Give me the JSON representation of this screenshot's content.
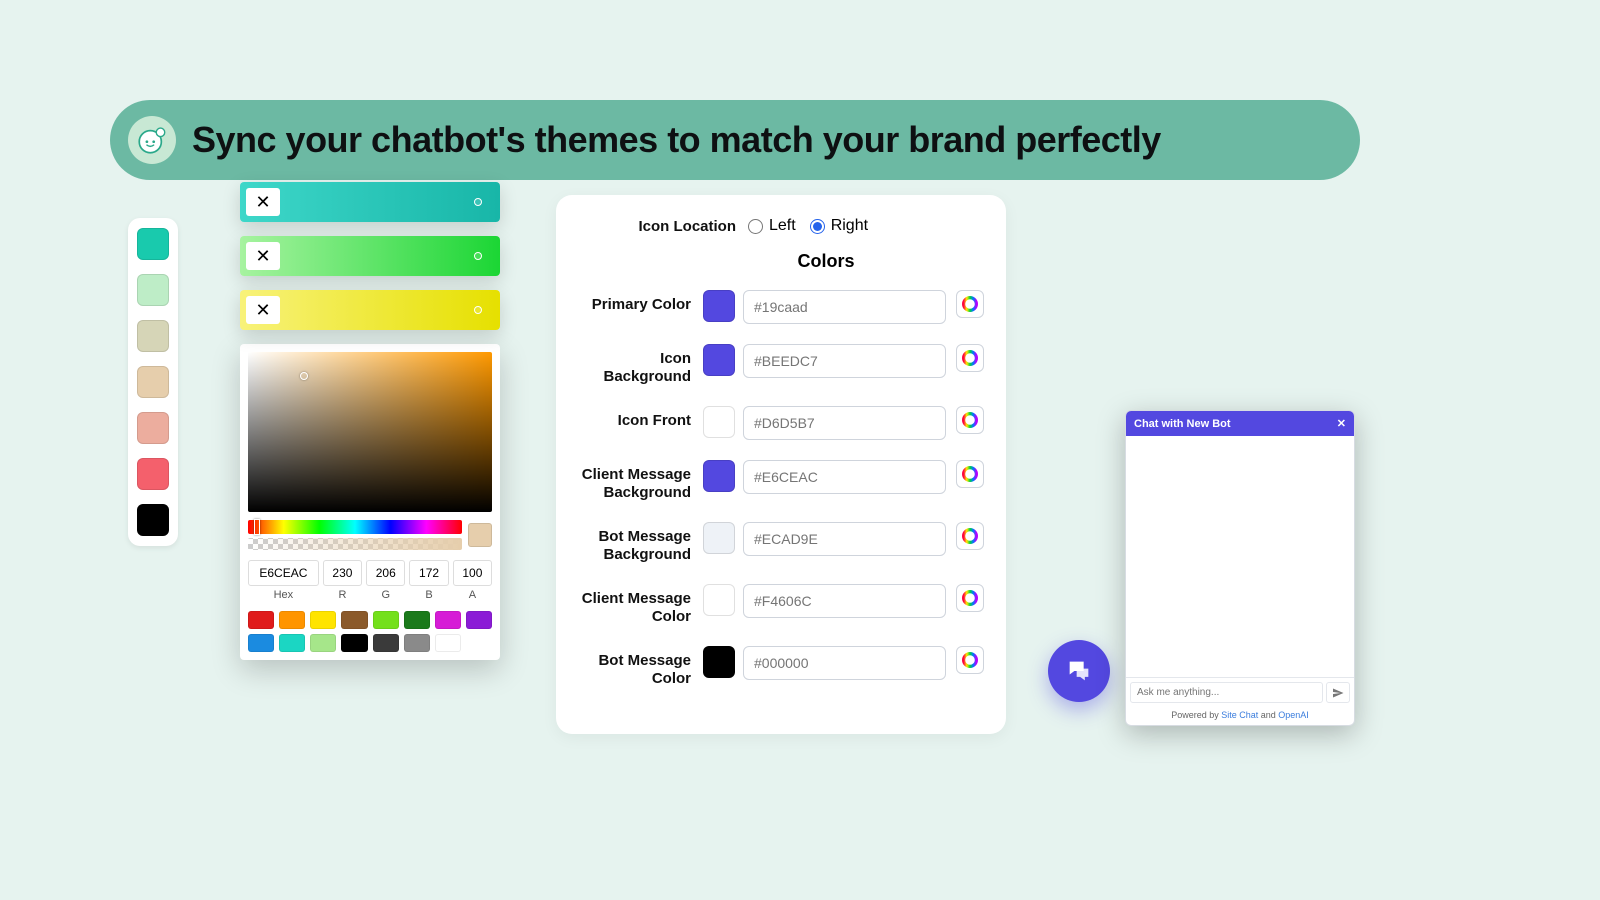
{
  "banner": {
    "title": "Sync your chatbot's themes to match your brand perfectly"
  },
  "palette_swatches": [
    "#19caad",
    "#beedc7",
    "#d6d5b7",
    "#e6ceac",
    "#ecad9e",
    "#f4606c",
    "#000000"
  ],
  "pickers": {
    "collapsed": [
      {
        "bg": "linear-gradient(to right,#3ed7c9,#18b6a8)"
      },
      {
        "bg": "linear-gradient(to right,#a7f3a0,#1bd634)"
      },
      {
        "bg": "linear-gradient(to right,#f8f27a,#e6e000)"
      }
    ],
    "hex": "E6CEAC",
    "r": "230",
    "g": "206",
    "b": "172",
    "a": "100",
    "labels": {
      "hex": "Hex",
      "r": "R",
      "g": "G",
      "b": "B",
      "a": "A"
    },
    "presets": [
      "#e01b1b",
      "#ff9500",
      "#ffe400",
      "#8b5a2b",
      "#74e01b",
      "#1b7a1b",
      "#d61bd6",
      "#8b1bd6",
      "#1b8be0",
      "#1bd6c3",
      "#a6e68a",
      "#000000",
      "#3a3a3a",
      "#8a8a8a",
      "#ffffff"
    ]
  },
  "form": {
    "icon_location_label": "Icon Location",
    "left_label": "Left",
    "right_label": "Right",
    "colors_heading": "Colors",
    "rows": [
      {
        "label": "Primary Color",
        "swatch": "#5348e0",
        "placeholder": "#19caad"
      },
      {
        "label": "Icon Background",
        "swatch": "#5348e0",
        "placeholder": "#BEEDC7"
      },
      {
        "label": "Icon Front",
        "swatch": "#ffffff",
        "placeholder": "#D6D5B7"
      },
      {
        "label": "Client Message Background",
        "swatch": "#5348e0",
        "placeholder": "#E6CEAC"
      },
      {
        "label": "Bot Message Background",
        "swatch": "#eef2f7",
        "placeholder": "#ECAD9E"
      },
      {
        "label": "Client Message Color",
        "swatch": "#ffffff",
        "placeholder": "#F4606C"
      },
      {
        "label": "Bot Message Color",
        "swatch": "#000000",
        "placeholder": "#000000"
      }
    ]
  },
  "chat": {
    "title": "Chat with New Bot",
    "placeholder": "Ask me anything...",
    "powered_pre": "Powered by ",
    "powered_link1": "Site Chat",
    "powered_mid": " and ",
    "powered_link2": "OpenAI"
  }
}
